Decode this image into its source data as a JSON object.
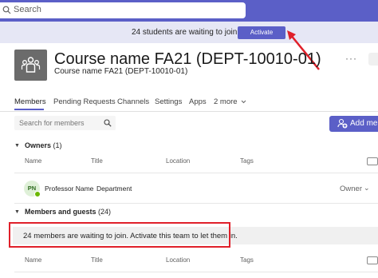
{
  "topbar": {
    "search_placeholder": "Search"
  },
  "banner": {
    "message": "24 students are waiting to join.",
    "activate_label": "Activate"
  },
  "team": {
    "name": "Course name FA21 (DEPT-10010-01)",
    "subtitle": "Course name FA21 (DEPT-10010-01)",
    "more_label": "···"
  },
  "tabs": [
    "Members",
    "Pending Requests",
    "Channels",
    "Settings",
    "Apps",
    "2 more"
  ],
  "members_toolbar": {
    "search_placeholder": "Search for members",
    "add_label": "Add mem"
  },
  "owners": {
    "title": "Owners",
    "count": "(1)",
    "columns": [
      "Name",
      "Title",
      "Location",
      "Tags"
    ],
    "rows": [
      {
        "initials": "PN",
        "name": "Professor Name",
        "title": "Department",
        "role": "Owner"
      }
    ]
  },
  "guests": {
    "title": "Members and guests",
    "count": "(24)",
    "notice": "24 members are waiting to join. Activate this team to let them in.",
    "columns": [
      "Name",
      "Title",
      "Location",
      "Tags"
    ]
  },
  "colors": {
    "brand": "#5b5fc7",
    "banner_bg": "#e6e7f5",
    "callout_red": "#e0202a"
  }
}
